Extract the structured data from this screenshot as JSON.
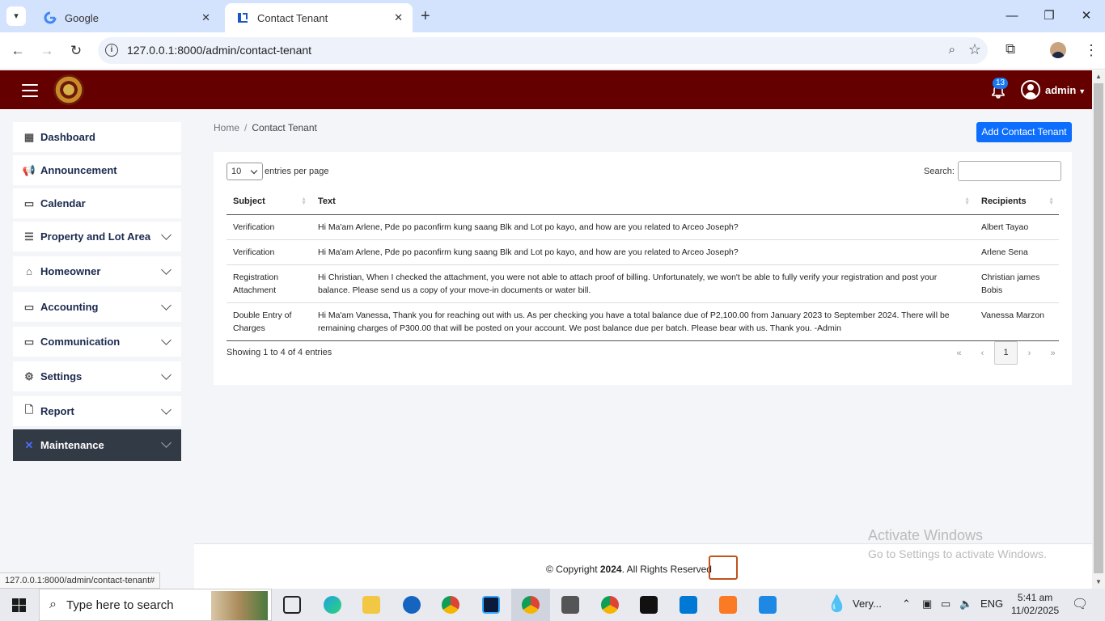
{
  "browser": {
    "tabs": [
      {
        "title": "Google",
        "icon": "google-g-icon"
      },
      {
        "title": "Contact Tenant",
        "icon": "site-logo-icon"
      }
    ],
    "url": "127.0.0.1:8000/admin/contact-tenant",
    "status_url": "127.0.0.1:8000/admin/contact-tenant#"
  },
  "appbar": {
    "notification_count": "13",
    "user_name": "admin",
    "bg_color": "#650000"
  },
  "sidebar": {
    "items": [
      {
        "label": "Dashboard",
        "icon": "grid-icon"
      },
      {
        "label": "Announcement",
        "icon": "megaphone-icon"
      },
      {
        "label": "Calendar",
        "icon": "calendar-icon"
      },
      {
        "label": "Property and Lot Area",
        "icon": "list-icon"
      },
      {
        "label": "Homeowner",
        "icon": "home-icon"
      },
      {
        "label": "Accounting",
        "icon": "wallet-icon"
      },
      {
        "label": "Communication",
        "icon": "chat-icon"
      },
      {
        "label": "Settings",
        "icon": "gear-icon"
      },
      {
        "label": "Report",
        "icon": "file-icon"
      },
      {
        "label": "Maintenance",
        "icon": "tools-icon"
      }
    ]
  },
  "main": {
    "breadcrumb": {
      "home": "Home",
      "current": "Contact Tenant"
    },
    "add_button": "Add Contact Tenant",
    "length_value": "10",
    "length_label": "entries per page",
    "search_label": "Search:",
    "columns": [
      "Subject",
      "Text",
      "Recipients"
    ],
    "rows": [
      {
        "subject": "Verification",
        "text": "Hi Ma'am Arlene, Pde po paconfirm kung saang Blk and Lot po kayo, and how are you related to Arceo Joseph?",
        "recipients": "Albert Tayao"
      },
      {
        "subject": "Verification",
        "text": "Hi Ma'am Arlene, Pde po paconfirm kung saang Blk and Lot po kayo, and how are you related to Arceo Joseph?",
        "recipients": "Arlene Sena"
      },
      {
        "subject": "Registration Attachment",
        "text": "Hi Christian, When I checked the attachment, you were not able to attach proof of billing. Unfortunately, we won't be able to fully verify your registration and post your balance. Please send us a copy of your move-in documents or water bill.",
        "recipients": "Christian james Bobis"
      },
      {
        "subject": "Double Entry of Charges",
        "text": "Hi Ma'am Vanessa, Thank you for reaching out with us. As per checking you have a total balance due of P2,100.00 from January 2023 to September 2024. There will be remaining charges of P300.00 that will be posted on your account. We post balance due per batch. Please bear with us. Thank you. -Admin",
        "recipients": "Vanessa Marzon"
      }
    ],
    "info": "Showing 1 to 4 of 4 entries",
    "pager": {
      "first": "«",
      "prev": "‹",
      "current": "1",
      "next": "›",
      "last": "»"
    }
  },
  "footer": {
    "copyright_prefix": "© Copyright ",
    "year": "2024",
    "copyright_suffix": ". All Rights Reserved"
  },
  "watermark": {
    "line1": "Activate Windows",
    "line2": "Go to Settings to activate Windows."
  },
  "taskbar": {
    "search_placeholder": "Type here to search",
    "weather": "Very...",
    "lang": "ENG",
    "time": "5:41 am",
    "date": "11/02/2025"
  }
}
